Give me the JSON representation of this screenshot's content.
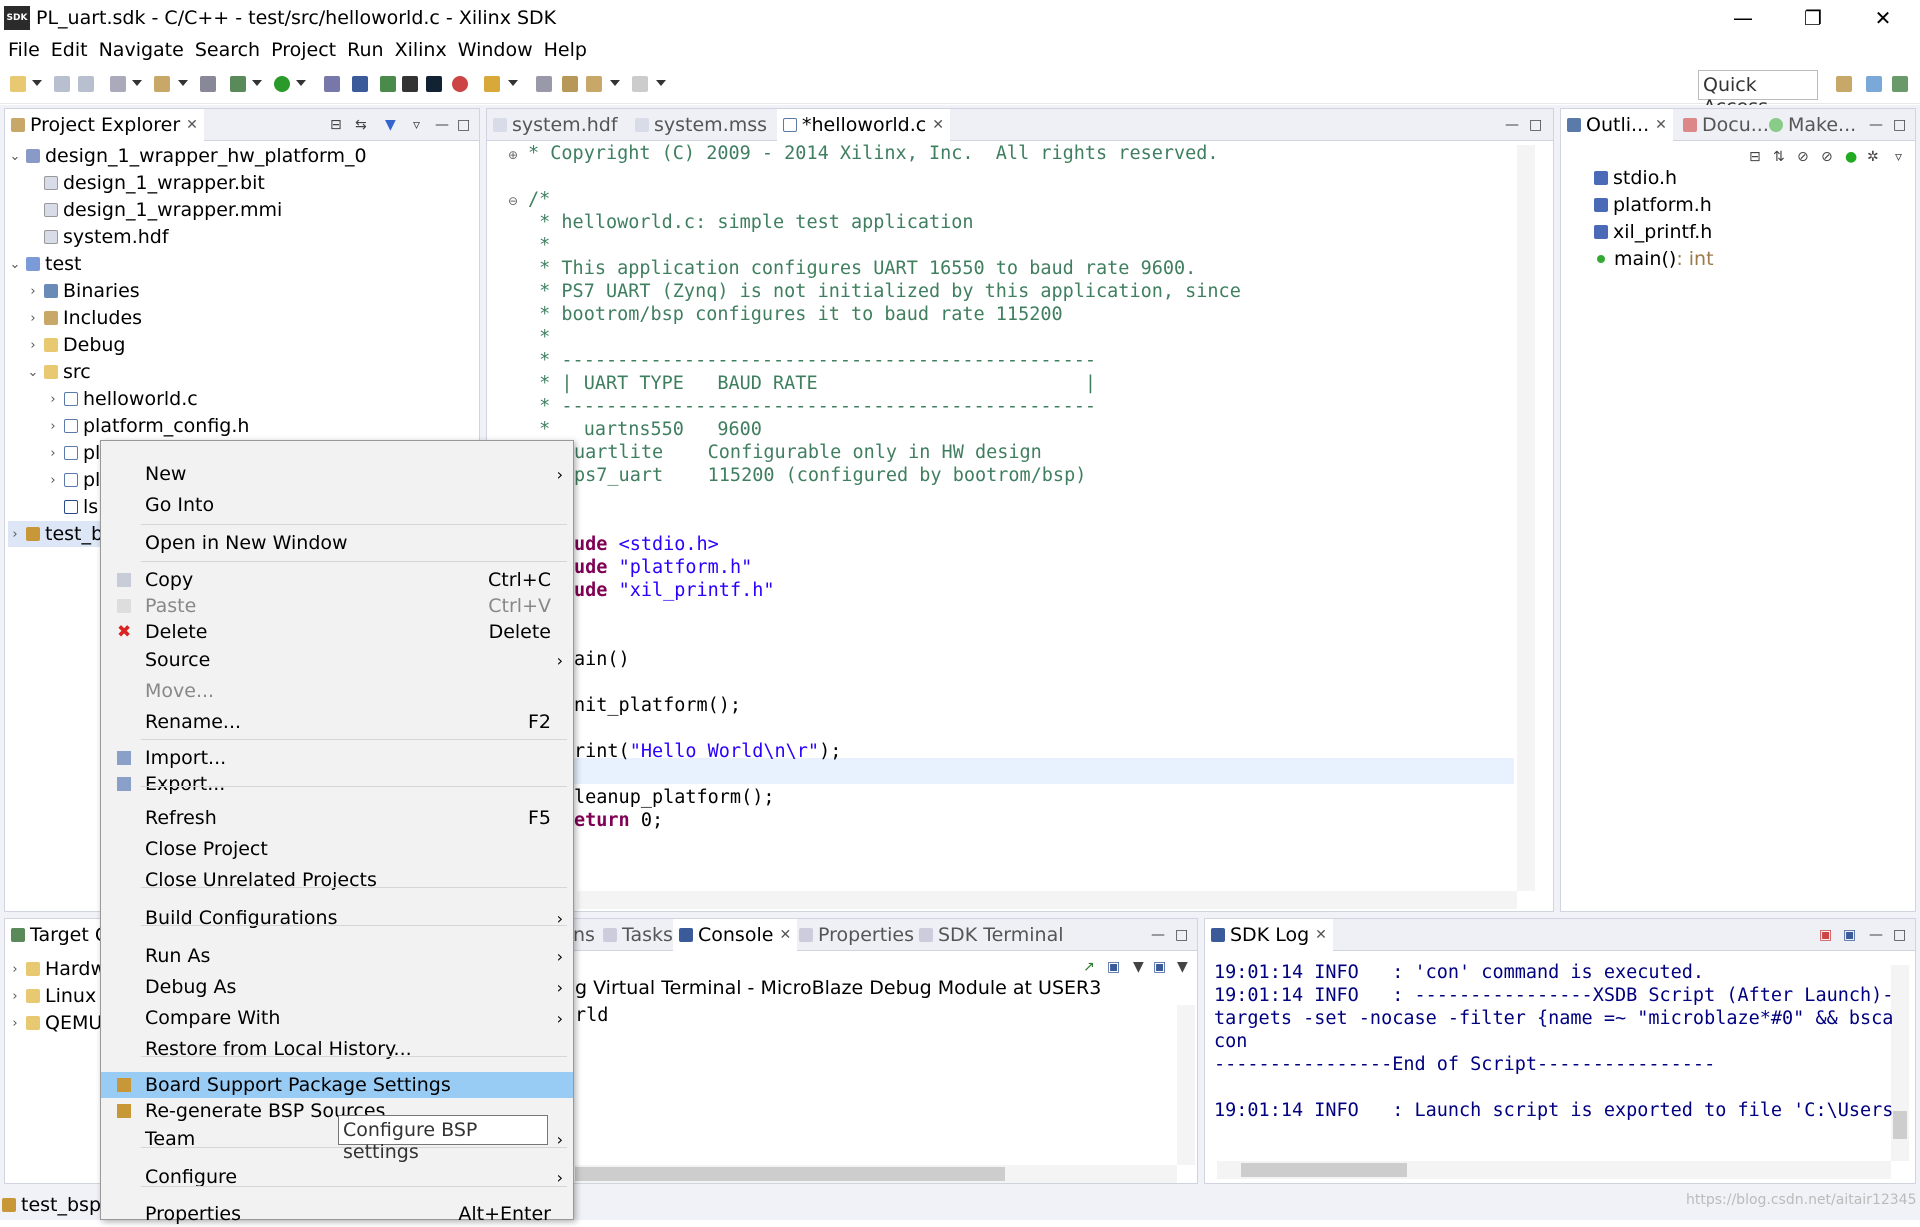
{
  "window": {
    "title": "PL_uart.sdk - C/C++ - test/src/helloworld.c - Xilinx SDK",
    "logo": "SDK"
  },
  "menu": [
    "File",
    "Edit",
    "Navigate",
    "Search",
    "Project",
    "Run",
    "Xilinx",
    "Window",
    "Help"
  ],
  "toolbar": {
    "quick_access": "Quick Access"
  },
  "project_explorer": {
    "tab": "Project Explorer",
    "rows": [
      {
        "label": "design_1_wrapper_hw_platform_0",
        "icon": "hw-platform-icon"
      },
      {
        "label": "design_1_wrapper.bit",
        "icon": "file-icon"
      },
      {
        "label": "design_1_wrapper.mmi",
        "icon": "file-icon"
      },
      {
        "label": "system.hdf",
        "icon": "file-icon"
      },
      {
        "label": "test",
        "icon": "c-project-icon"
      },
      {
        "label": "Binaries",
        "icon": "binaries-icon"
      },
      {
        "label": "Includes",
        "icon": "includes-icon"
      },
      {
        "label": "Debug",
        "icon": "folder-icon"
      },
      {
        "label": "src",
        "icon": "folder-icon"
      },
      {
        "label": "helloworld.c",
        "icon": "c-file-icon"
      },
      {
        "label": "platform_config.h",
        "icon": "h-file-icon"
      },
      {
        "label": "pl",
        "icon": "c-file-icon"
      },
      {
        "label": "pl",
        "icon": "h-file-icon"
      },
      {
        "label": "ls",
        "icon": "linker-icon"
      },
      {
        "label": "test_b",
        "icon": "bsp-icon"
      }
    ]
  },
  "editor": {
    "tabs": [
      "system.hdf",
      "system.mss",
      "*helloworld.c"
    ],
    "lines": [
      "* Copyright (C) 2009 - 2014 Xilinx, Inc.  All rights reserved.",
      "/*",
      " * helloworld.c: simple test application",
      " *",
      " * This application configures UART 16550 to baud rate 9600.",
      " * PS7 UART (Zynq) is not initialized by this application, since",
      " * bootrom/bsp configures it to baud rate 115200",
      " *",
      " * ------------------------------------------------",
      " * | UART TYPE   BAUD RATE                        |",
      " * ------------------------------------------------",
      " *   uartns550   9600",
      "uartlite    Configurable only in HW design",
      "ps7_uart    115200 (configured by bootrom/bsp)",
      "ude ",
      "<stdio.h>",
      "ude ",
      "\"platform.h\"",
      "ude ",
      "\"xil_printf.h\"",
      "ain()",
      "nit_platform();",
      "rint(",
      "\"Hello World\\n\\r\"",
      ");",
      "leanup_platform();",
      "eturn",
      " 0;"
    ]
  },
  "outline": {
    "tabs": [
      "Outli...",
      "Docu...",
      "Make..."
    ],
    "items": [
      {
        "label": "stdio.h",
        "type": ""
      },
      {
        "label": "platform.h",
        "type": ""
      },
      {
        "label": "xil_printf.h",
        "type": ""
      },
      {
        "label": "main()",
        "type": " : int"
      }
    ]
  },
  "target": {
    "tab": "Target C",
    "items": [
      "Hardw",
      "Linux",
      "QEMU"
    ]
  },
  "console": {
    "tabs": [
      "ns",
      "Tasks",
      "Console",
      "Properties",
      "SDK Terminal"
    ],
    "header": "g Virtual Terminal - MicroBlaze Debug Module at USER3",
    "body": "rld"
  },
  "sdklog": {
    "tab": "SDK Log",
    "lines": [
      "19:01:14 INFO   : 'con' command is executed.",
      "19:01:14 INFO   : ----------------XSDB Script (After Launch)-",
      "targets -set -nocase -filter {name =~ \"microblaze*#0\" && bsca",
      "con",
      "----------------End of Script----------------",
      "",
      "19:01:14 INFO   : Launch script is exported to file 'C:\\Users"
    ]
  },
  "context_menu": {
    "items": [
      {
        "label": "New",
        "shortcut": "",
        "submenu": true
      },
      {
        "label": "Go Into",
        "shortcut": ""
      },
      {
        "label": "Open in New Window",
        "shortcut": ""
      },
      {
        "label": "Copy",
        "shortcut": "Ctrl+C"
      },
      {
        "label": "Paste",
        "shortcut": "Ctrl+V",
        "disabled": true
      },
      {
        "label": "Delete",
        "shortcut": "Delete"
      },
      {
        "label": "Source",
        "shortcut": "",
        "submenu": true
      },
      {
        "label": "Move...",
        "shortcut": "",
        "disabled": true
      },
      {
        "label": "Rename...",
        "shortcut": "F2"
      },
      {
        "label": "Import...",
        "shortcut": ""
      },
      {
        "label": "Export...",
        "shortcut": ""
      },
      {
        "label": "Refresh",
        "shortcut": "F5"
      },
      {
        "label": "Close Project",
        "shortcut": ""
      },
      {
        "label": "Close Unrelated Projects",
        "shortcut": ""
      },
      {
        "label": "Build Configurations",
        "shortcut": "",
        "submenu": true
      },
      {
        "label": "Run As",
        "shortcut": "",
        "submenu": true
      },
      {
        "label": "Debug As",
        "shortcut": "",
        "submenu": true
      },
      {
        "label": "Compare With",
        "shortcut": "",
        "submenu": true
      },
      {
        "label": "Restore from Local History...",
        "shortcut": ""
      },
      {
        "label": "Board Support Package Settings",
        "shortcut": "",
        "highlighted": true
      },
      {
        "label": "Re-generate BSP Sources",
        "shortcut": ""
      },
      {
        "label": "Team",
        "shortcut": "",
        "submenu": true
      },
      {
        "label": "Configure",
        "shortcut": "",
        "submenu": true
      },
      {
        "label": "Properties",
        "shortcut": "Alt+Enter"
      }
    ],
    "tooltip": "Configure BSP settings"
  },
  "bottom_left": {
    "label": "test_bsp"
  },
  "watermark": "https://blog.csdn.net/aitair12345",
  "colors": {
    "selection": "#99ccf5",
    "comment": "#3f7f5f",
    "keyword": "#7f0055",
    "string": "#2a00ff",
    "log": "#000080"
  }
}
